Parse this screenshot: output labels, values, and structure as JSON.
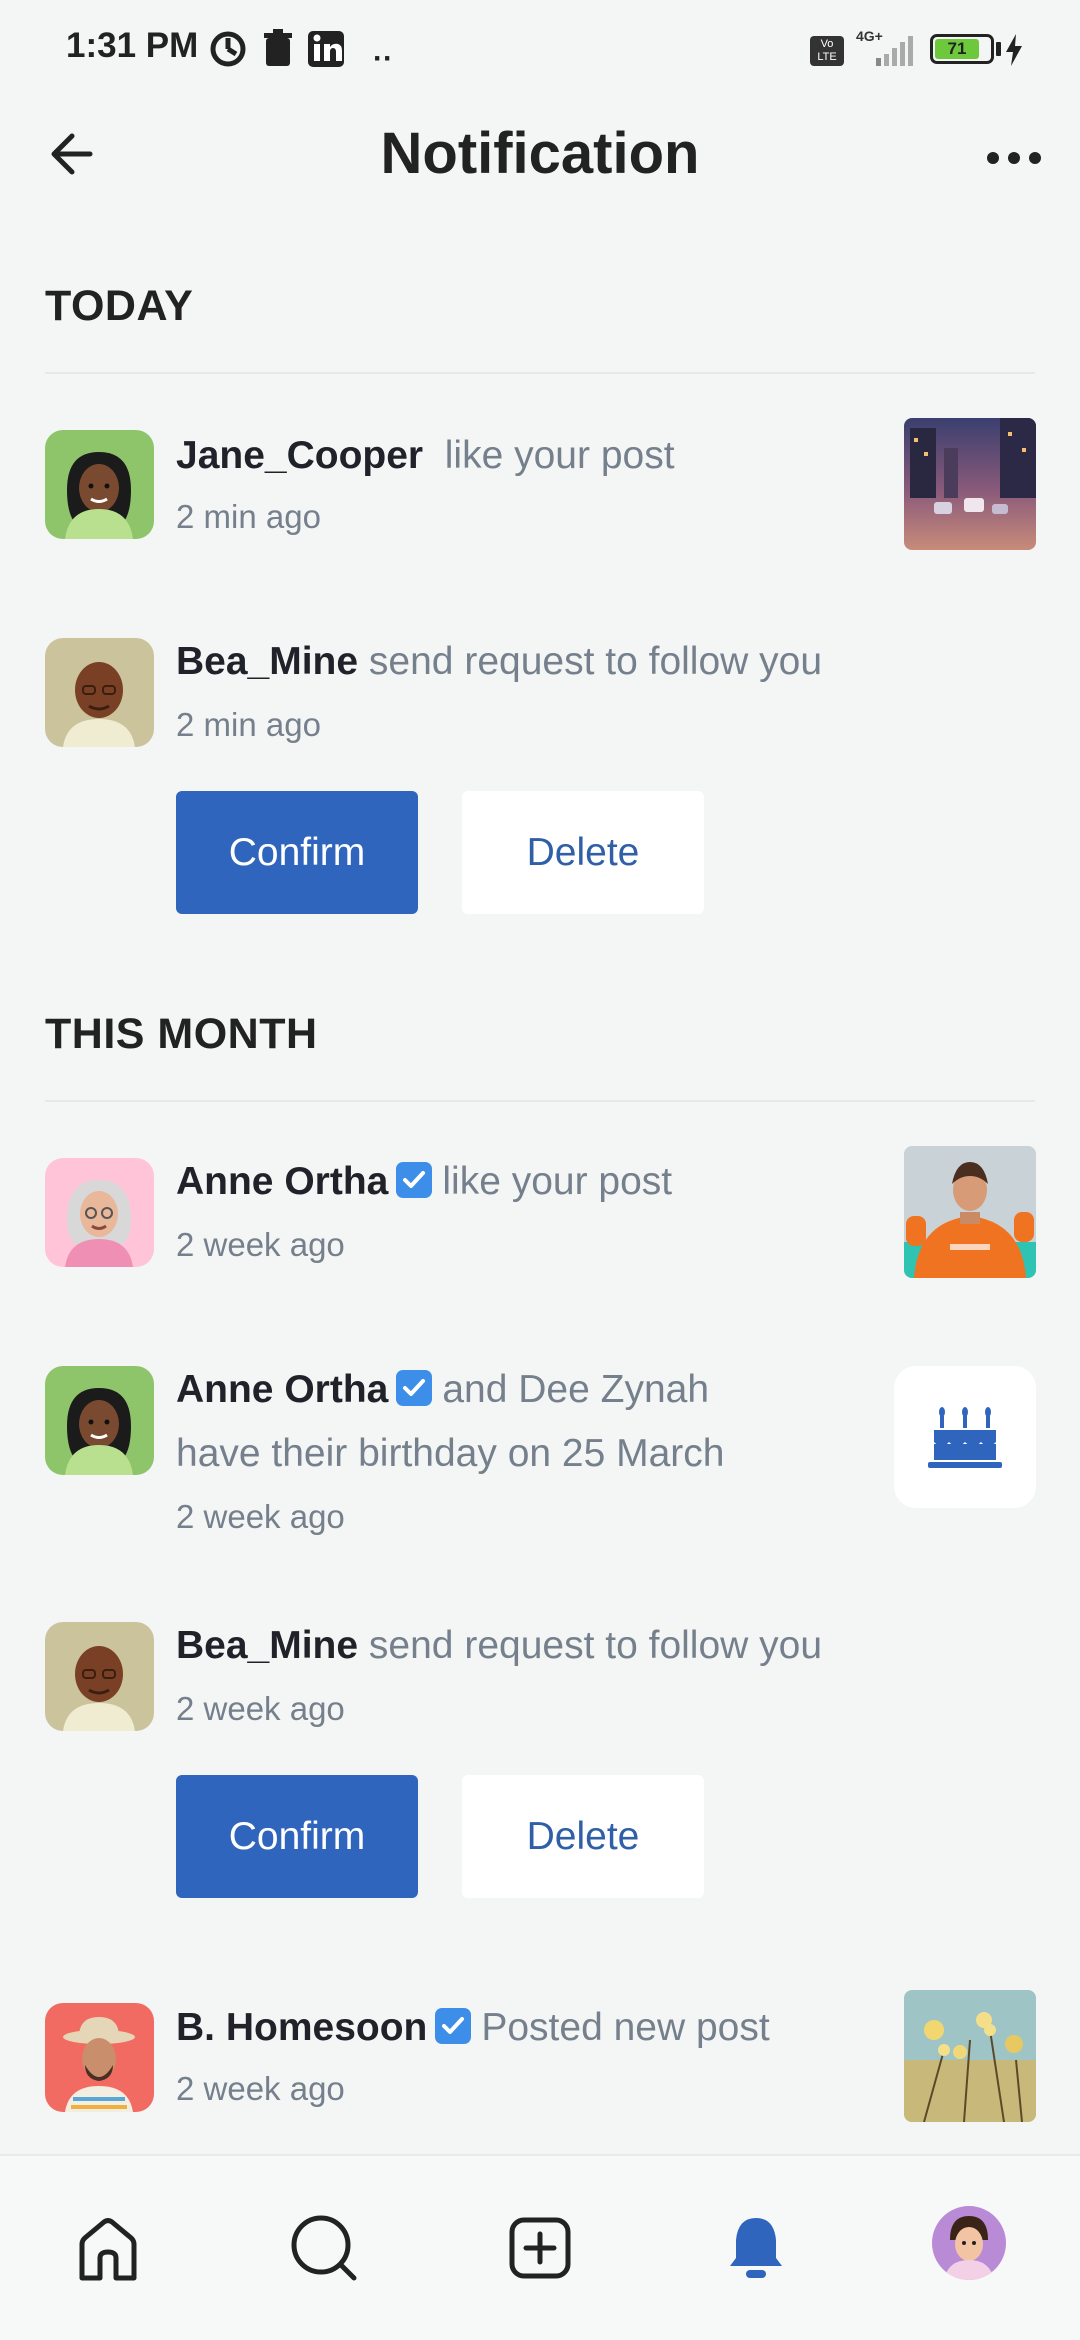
{
  "status_bar": {
    "time": "1:31 PM",
    "battery": "71",
    "network": "4G+",
    "lte": "Vo LTE"
  },
  "header": {
    "title": "Notification"
  },
  "sections": {
    "today": "TODAY",
    "month": "THIS MONTH"
  },
  "notifications": [
    {
      "user": "Jane_Cooper",
      "action": "like your post",
      "time": "2 min ago"
    },
    {
      "user": "Bea_Mine",
      "action": "send request to follow you",
      "time": "2 min ago",
      "confirm": "Confirm",
      "delete": "Delete"
    },
    {
      "user": "Anne Ortha",
      "action": "like your post",
      "time": "2 week ago"
    },
    {
      "user": "Anne Ortha",
      "action": "and Dee Zynah",
      "action2": "have their birthday on 25 March",
      "time": "2 week ago"
    },
    {
      "user": "Bea_Mine",
      "action": "send request to follow you",
      "time": "2 week ago",
      "confirm": "Confirm",
      "delete": "Delete"
    },
    {
      "user": "B. Homesoon",
      "action": "Posted new post",
      "time": "2 week ago"
    }
  ],
  "colors": {
    "primary": "#2f65bd",
    "verified": "#3d8ee8",
    "muted": "#75808c",
    "background": "#f4f6f6"
  },
  "nav": [
    "home-icon",
    "search-icon",
    "add-post-icon",
    "notification-bell-icon",
    "profile-avatar"
  ]
}
